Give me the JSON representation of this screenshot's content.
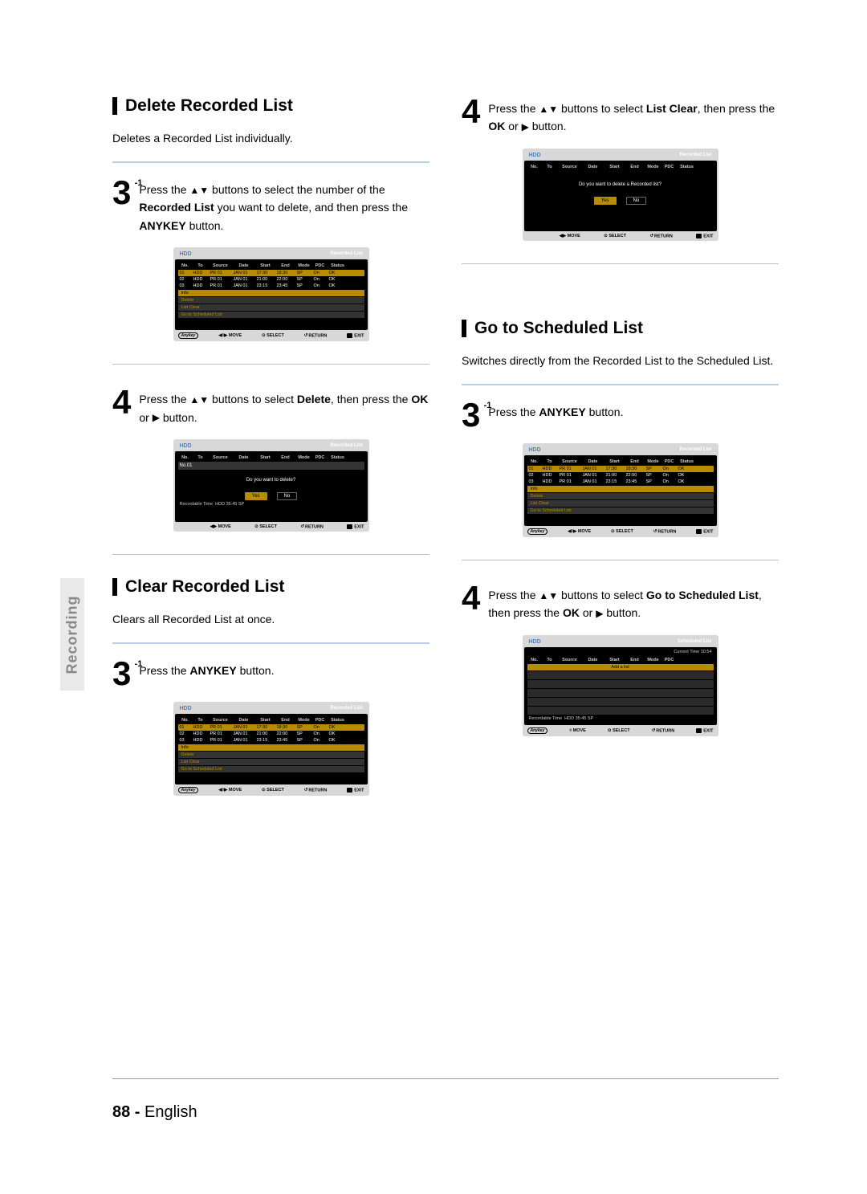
{
  "sideTab": "Recording",
  "pageNumber": "88 -",
  "pageLang": "English",
  "symbols": {
    "upDown": "▲▼",
    "play": "▶",
    "leftRight": "◀▶",
    "move4": "◀◊▶",
    "return": "↺",
    "ok": "OK"
  },
  "osdCommon": {
    "titleLeft": "HDD",
    "titleRight": "Recorded List",
    "titleRightScheduled": "Scheduled List",
    "currentTime": "Current Time 10:54",
    "cols": {
      "no": "No.",
      "to": "To",
      "src": "Source",
      "date": "Date",
      "start": "Start",
      "end": "End",
      "mode": "Mode",
      "pdc": "PDC",
      "status": "Status"
    },
    "footer": {
      "anykey": "Anykey",
      "move": "MOVE",
      "select": "SELECT",
      "return": "RETURN",
      "exit": "EXIT"
    },
    "ctxMenu": {
      "info": "Info",
      "delete": "Delete",
      "listClear": "List Clear",
      "goto": "Go to Scheduled List"
    },
    "recordableTime": "Recordable Time",
    "recordableVal": "HDD  35:45 SP",
    "addList": "Add a list",
    "rows": [
      {
        "no": "01",
        "to": "HDD",
        "src": "PR 01",
        "date": "JAN 01",
        "start": "17:30",
        "end": "18:30",
        "mode": "SP",
        "pdc": "On",
        "status": "OK"
      },
      {
        "no": "02",
        "to": "HDD",
        "src": "PR 01",
        "date": "JAN 01",
        "start": "21:00",
        "end": "22:00",
        "mode": "SP",
        "pdc": "On",
        "status": "OK"
      },
      {
        "no": "03",
        "to": "HDD",
        "src": "PR 01",
        "date": "JAN 01",
        "start": "23:15",
        "end": "23:45",
        "mode": "SP",
        "pdc": "On",
        "status": "OK"
      }
    ],
    "confirmDelete": "Do you want to delete?",
    "confirmDeleteList": "Do you want to delete a Recorded list?",
    "no01": "No.01",
    "yes": "Yes",
    "no": "No"
  },
  "sections": {
    "delete": {
      "heading": "Delete Recorded List",
      "desc": "Deletes a Recorded List individually.",
      "step3_pre": "Press the ",
      "step3_mid": " buttons to select the number of the ",
      "step3_bold": "Recorded List",
      "step3_post": " you want to delete, and then press the ",
      "step3_bold2": "ANYKEY",
      "step3_end": " button.",
      "step4_pre": "Press the ",
      "step4_mid": " buttons to select ",
      "step4_bold": "Delete",
      "step4_post": ", then press the ",
      "step4_bold2": "OK",
      "step4_or": " or ",
      "step4_end": " button."
    },
    "clear": {
      "heading": "Clear Recorded List",
      "desc": "Clears all Recorded List at once.",
      "step3_pre": "Press the ",
      "step3_bold": "ANYKEY",
      "step3_end": " button."
    },
    "listClear": {
      "step4_pre": "Press the ",
      "step4_mid": " buttons to select ",
      "step4_bold": "List Clear",
      "step4_post": ", then press the ",
      "step4_bold2": "OK",
      "step4_or": " or ",
      "step4_end": " button."
    },
    "goto": {
      "heading": "Go to Scheduled List",
      "desc": "Switches directly from the Recorded List to the Scheduled List.",
      "step3_pre": "Press the ",
      "step3_bold": "ANYKEY",
      "step3_end": " button.",
      "step4_pre": "Press the ",
      "step4_mid": " buttons to select  ",
      "step4_bold": "Go to Scheduled List",
      "step4_post": ", then press the ",
      "step4_bold2": "OK",
      "step4_or": " or ",
      "step4_end": " button."
    }
  }
}
